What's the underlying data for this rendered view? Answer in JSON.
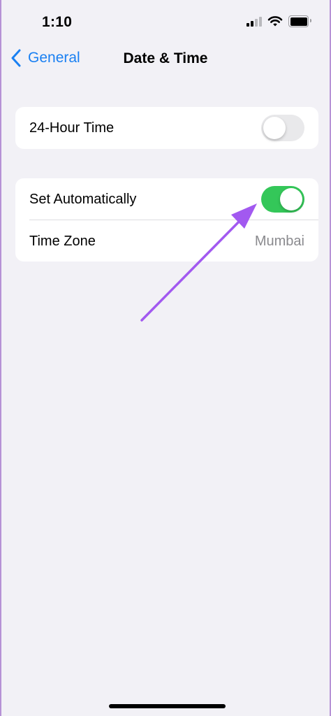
{
  "status_bar": {
    "time": "1:10"
  },
  "nav": {
    "back_label": "General",
    "title": "Date & Time"
  },
  "settings": {
    "group1": {
      "hour24": {
        "label": "24-Hour Time",
        "on": false
      }
    },
    "group2": {
      "set_automatically": {
        "label": "Set Automatically",
        "on": true
      },
      "time_zone": {
        "label": "Time Zone",
        "value": "Mumbai"
      }
    }
  },
  "colors": {
    "accent": "#1a80f2",
    "toggle_on": "#34c759",
    "annotation_arrow": "#a259f0"
  }
}
